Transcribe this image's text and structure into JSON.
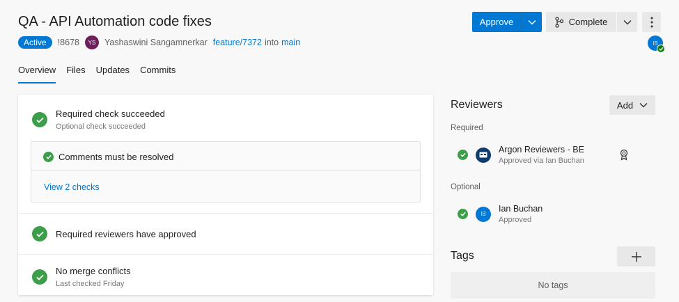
{
  "header": {
    "title": "QA - API Automation code fixes",
    "status_badge": "Active",
    "pr_id": "!8678",
    "author_initials": "YS",
    "author_name": "Yashaswini Sangamnerkar",
    "source_branch": "feature/7372",
    "into_text": "into",
    "target_branch": "main",
    "current_user_initials": "IB"
  },
  "actions": {
    "approve_label": "Approve",
    "complete_label": "Complete"
  },
  "tabs": [
    {
      "label": "Overview",
      "active": true
    },
    {
      "label": "Files",
      "active": false
    },
    {
      "label": "Updates",
      "active": false
    },
    {
      "label": "Commits",
      "active": false
    }
  ],
  "checks": {
    "required_check": {
      "title": "Required check succeeded",
      "subtitle": "Optional check succeeded"
    },
    "comments_check": "Comments must be resolved",
    "view_checks_link": "View 2 checks",
    "reviewers_check": "Required reviewers have approved",
    "merge_check": {
      "title": "No merge conflicts",
      "subtitle": "Last checked Friday"
    }
  },
  "reviewers": {
    "title": "Reviewers",
    "add_label": "Add",
    "required_label": "Required",
    "optional_label": "Optional",
    "required": [
      {
        "name": "Argon Reviewers - BE",
        "status": "Approved via Ian Buchan",
        "avatar": "group-icon"
      }
    ],
    "optional": [
      {
        "name": "Ian Buchan",
        "status": "Approved",
        "initials": "IB"
      }
    ]
  },
  "tags": {
    "title": "Tags",
    "empty_text": "No tags"
  },
  "colors": {
    "accent": "#0078d4",
    "success": "#3d9e4a",
    "author_avatar": "#6b1f5b"
  }
}
